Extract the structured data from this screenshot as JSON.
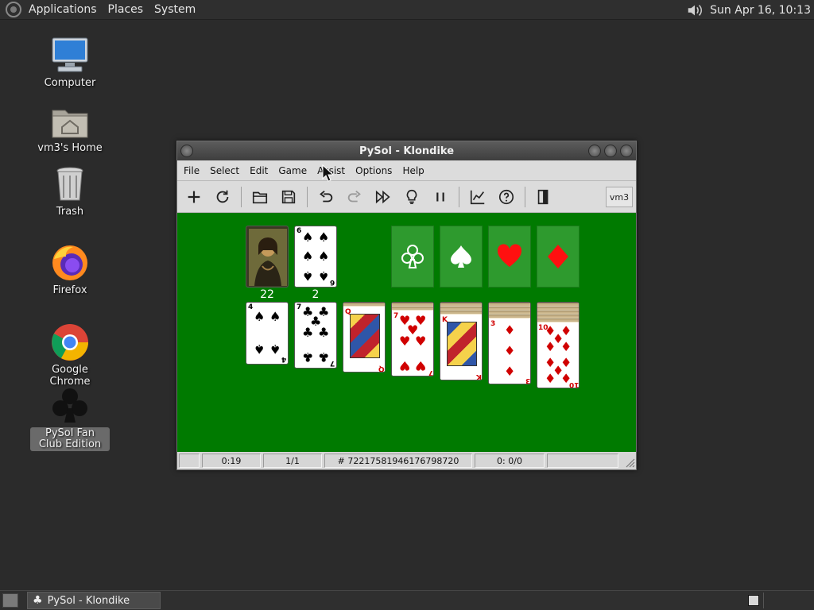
{
  "top_panel": {
    "menus": [
      "Applications",
      "Places",
      "System"
    ],
    "datetime": "Sun Apr 16, 10:13"
  },
  "desktop_icons": [
    {
      "label": "Computer",
      "icon": "computer-icon"
    },
    {
      "label": "vm3's Home",
      "icon": "home-folder-icon"
    },
    {
      "label": "Trash",
      "icon": "trash-icon"
    },
    {
      "label": "Firefox",
      "icon": "firefox-icon"
    },
    {
      "label": "Google Chrome",
      "icon": "chrome-icon"
    },
    {
      "label": "PySol Fan Club Edition",
      "icon": "pysol-club-icon"
    }
  ],
  "window": {
    "title": "PySol - Klondike",
    "menus": [
      "File",
      "Select",
      "Edit",
      "Game",
      "Assist",
      "Options",
      "Help"
    ],
    "player": "vm3",
    "toolbar": [
      "new-game-icon",
      "restart-icon",
      "open-icon",
      "save-icon",
      "undo-icon",
      "redo-icon",
      "autodrop-icon",
      "hint-icon",
      "pause-icon",
      "statistics-icon",
      "help-icon",
      "quit-icon"
    ]
  },
  "table": {
    "talon_count": "22",
    "waste_count": "2",
    "waste_card": {
      "rank": "6",
      "suit": "spades"
    },
    "foundations": [
      "clubs",
      "spades",
      "hearts",
      "diamonds"
    ],
    "tableau": [
      {
        "face_down": 0,
        "rank": "4",
        "suit": "spades"
      },
      {
        "face_down": 0,
        "rank": "7",
        "suit": "clubs"
      },
      {
        "face_down": 1,
        "rank": "Q",
        "suit": "diamonds"
      },
      {
        "face_down": 2,
        "rank": "7",
        "suit": "hearts"
      },
      {
        "face_down": 3,
        "rank": "K",
        "suit": "diamonds"
      },
      {
        "face_down": 4,
        "rank": "3",
        "suit": "diamonds"
      },
      {
        "face_down": 5,
        "rank": "10",
        "suit": "diamonds"
      }
    ]
  },
  "statusbar": {
    "time": "0:19",
    "moves": "1/1",
    "game_number": "# 72217581946176798720",
    "stats": "0: 0/0"
  },
  "taskbar": {
    "task_label": "PySol - Klondike"
  },
  "colors": {
    "table_green": "#007a00",
    "slot_green": "#2e9a2e"
  }
}
